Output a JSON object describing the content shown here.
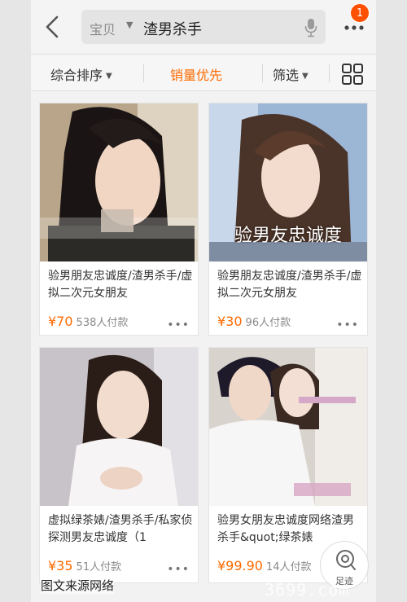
{
  "search": {
    "scope": "宝贝",
    "query": "渣男杀手"
  },
  "notifications": {
    "count": "1"
  },
  "sort": {
    "comprehensive": "综合排序",
    "sales": "销量优先",
    "filter": "筛选"
  },
  "products": [
    {
      "title": "验男朋友忠诚度/渣男杀手/虚拟二次元女朋友",
      "price": "¥70",
      "sold": "538人付款",
      "overlay": ""
    },
    {
      "title": "验男朋友忠诚度/渣男杀手/虚拟二次元女朋友",
      "price": "¥30",
      "sold": "96人付款",
      "overlay": "验男友忠诚度"
    },
    {
      "title": "虚拟绿茶婊/渣男杀手/私家侦探测男友忠诚度（1",
      "price": "¥35",
      "sold": "51人付款",
      "overlay": ""
    },
    {
      "title": "验男女朋友忠诚度网络渣男杀手&quot;绿茶婊",
      "price": "¥99.90",
      "sold": "14人付款",
      "overlay": ""
    }
  ],
  "footer": {
    "source_note": "图文来源网络",
    "float_label": "足迹",
    "watermark": "3699.com"
  },
  "colors": {
    "accent": "#ff6a00",
    "badge": "#ff5000"
  }
}
